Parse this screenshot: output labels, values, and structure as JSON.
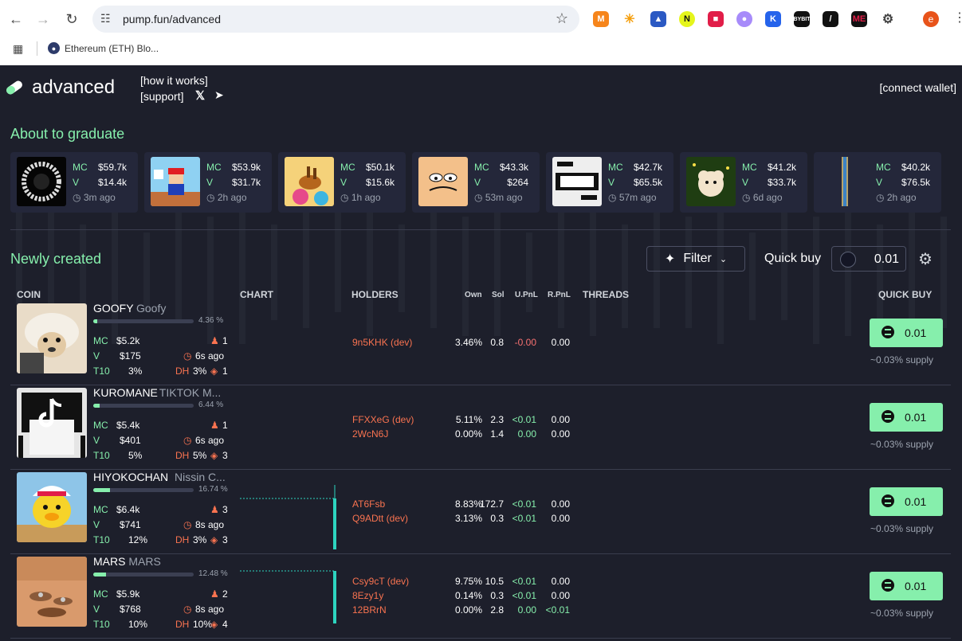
{
  "browser": {
    "url": "pump.fun/advanced",
    "bookmark": "Ethereum (ETH) Blo..."
  },
  "header": {
    "brand": "advanced",
    "how_it_works": "[how it works]",
    "support": "[support]",
    "connect_wallet": "[connect wallet]"
  },
  "graduate": {
    "title": "About to graduate",
    "cards": [
      {
        "mc": "$59.7k",
        "v": "$14.4k",
        "age": "3m ago"
      },
      {
        "mc": "$53.9k",
        "v": "$31.7k",
        "age": "2h ago"
      },
      {
        "mc": "$50.1k",
        "v": "$15.6k",
        "age": "1h ago"
      },
      {
        "mc": "$43.3k",
        "v": "$264",
        "age": "53m ago"
      },
      {
        "mc": "$42.7k",
        "v": "$65.5k",
        "age": "57m ago"
      },
      {
        "mc": "$41.2k",
        "v": "$33.7k",
        "age": "6d ago"
      },
      {
        "mc": "$40.2k",
        "v": "$76.5k",
        "age": "2h ago"
      }
    ],
    "mc_label": "MC",
    "v_label": "V"
  },
  "newly": {
    "title": "Newly created",
    "filter": "Filter",
    "quick_buy_label": "Quick buy",
    "quick_buy_value": "0.01"
  },
  "columns": {
    "coin": "COIN",
    "chart": "CHART",
    "holders": "HOLDERS",
    "own": "Own",
    "sol": "Sol",
    "upnl": "U.PnL",
    "rpnl": "R.PnL",
    "threads": "THREADS",
    "quick_buy": "QUICK BUY"
  },
  "labels": {
    "mc": "MC",
    "v": "V",
    "t10": "T10",
    "dh": "DH"
  },
  "rows": [
    {
      "ticker": "GOOFY",
      "name": "Goofy",
      "progress": 4.36,
      "progress_text": "4.36 %",
      "mc": "$5.2k",
      "v": "$175",
      "t10": "3%",
      "holders_count": "1",
      "age": "6s ago",
      "dh": "3%",
      "dh_count": "1",
      "holders": [
        {
          "addr": "9n5KHK (dev)",
          "own": "3.46%",
          "sol": "0.8",
          "upnl": "-0.00",
          "rpnl": "0.00"
        }
      ],
      "buy": "0.01",
      "supply": "~0.03% supply"
    },
    {
      "ticker": "KUROMANE",
      "name": "TIKTOK M...",
      "progress": 6.44,
      "progress_text": "6.44 %",
      "mc": "$5.4k",
      "v": "$401",
      "t10": "5%",
      "holders_count": "1",
      "age": "6s ago",
      "dh": "5%",
      "dh_count": "3",
      "holders": [
        {
          "addr": "FFXXeG (dev)",
          "own": "5.11%",
          "sol": "2.3",
          "upnl": "<0.01",
          "rpnl": "0.00"
        },
        {
          "addr": "2WcN6J",
          "own": "0.00%",
          "sol": "1.4",
          "upnl": "0.00",
          "rpnl": "0.00"
        }
      ],
      "buy": "0.01",
      "supply": "~0.03% supply"
    },
    {
      "ticker": "HIYOKOCHAN",
      "name": "Nissin C...",
      "progress": 16.74,
      "progress_text": "16.74 %",
      "mc": "$6.4k",
      "v": "$741",
      "t10": "12%",
      "holders_count": "3",
      "age": "8s ago",
      "dh": "3%",
      "dh_count": "3",
      "holders": [
        {
          "addr": "AT6Fsb",
          "own": "8.83%",
          "sol": "172.7",
          "upnl": "<0.01",
          "rpnl": "0.00"
        },
        {
          "addr": "Q9ADtt (dev)",
          "own": "3.13%",
          "sol": "0.3",
          "upnl": "<0.01",
          "rpnl": "0.00"
        }
      ],
      "buy": "0.01",
      "supply": "~0.03% supply"
    },
    {
      "ticker": "MARS",
      "name": "MARS",
      "progress": 12.48,
      "progress_text": "12.48 %",
      "mc": "$5.9k",
      "v": "$768",
      "t10": "10%",
      "holders_count": "2",
      "age": "8s ago",
      "dh": "10%",
      "dh_count": "4",
      "holders": [
        {
          "addr": "Csy9cT (dev)",
          "own": "9.75%",
          "sol": "10.5",
          "upnl": "<0.01",
          "rpnl": "0.00"
        },
        {
          "addr": "8Ezy1y",
          "own": "0.14%",
          "sol": "0.3",
          "upnl": "<0.01",
          "rpnl": "0.00"
        },
        {
          "addr": "12BRrN",
          "own": "0.00%",
          "sol": "2.8",
          "upnl": "0.00",
          "rpnl": "<0.01"
        }
      ],
      "buy": "0.01",
      "supply": "~0.03% supply"
    }
  ],
  "colors": {
    "accent": "#86efac",
    "holder": "#f97350",
    "background": "#1d1f2b"
  }
}
